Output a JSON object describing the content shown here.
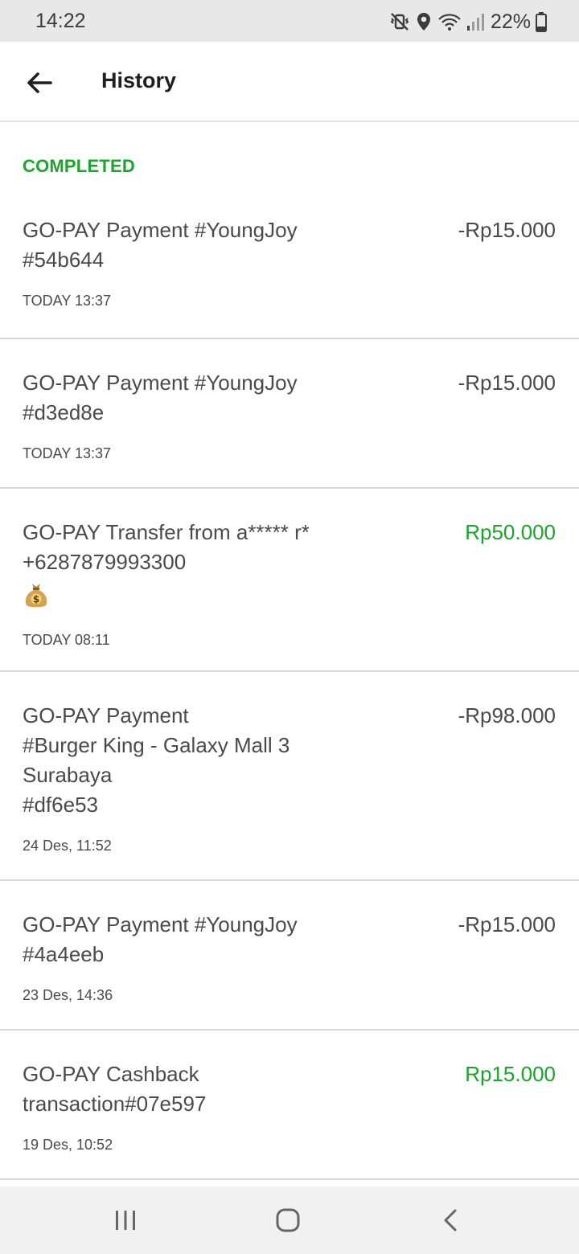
{
  "status_bar": {
    "time": "14:22",
    "battery_pct": "22%",
    "icons": [
      "mute-vibrate-icon",
      "location-icon",
      "wifi-icon",
      "signal-icon",
      "battery-icon"
    ]
  },
  "app_bar": {
    "title": "History",
    "back_icon": "arrow-left-icon"
  },
  "section": {
    "label": "COMPLETED",
    "color": "#1aa62a"
  },
  "transactions": [
    {
      "description": "GO-PAY Payment #YoungJoy\n#54b644",
      "amount": "-Rp15.000",
      "type": "debit",
      "date": "TODAY 13:37"
    },
    {
      "description": "GO-PAY Payment #YoungJoy\n#d3ed8e",
      "amount": "-Rp15.000",
      "type": "debit",
      "date": "TODAY 13:37"
    },
    {
      "description": "GO-PAY Transfer from a***** r*\n+6287879993300",
      "emoji": "money-bag-icon",
      "amount": "Rp50.000",
      "type": "credit",
      "date": "TODAY 08:11"
    },
    {
      "description": "GO-PAY Payment\n#Burger King - Galaxy Mall 3\nSurabaya\n#df6e53",
      "amount": "-Rp98.000",
      "type": "debit",
      "date": "24 Des, 11:52"
    },
    {
      "description": "GO-PAY Payment #YoungJoy\n#4a4eeb",
      "amount": "-Rp15.000",
      "type": "debit",
      "date": "23 Des, 14:36"
    },
    {
      "description": "GO-PAY Cashback\ntransaction#07e597",
      "amount": "Rp15.000",
      "type": "credit",
      "date": "19 Des, 10:52"
    }
  ],
  "nav_bar": {
    "buttons": [
      "recent-apps-icon",
      "home-icon",
      "back-icon"
    ]
  }
}
